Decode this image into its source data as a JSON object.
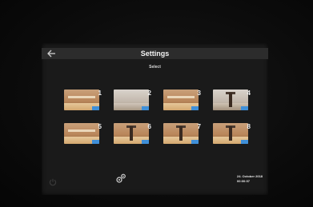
{
  "header": {
    "back_icon": "back-arrow-icon",
    "title": "Settings"
  },
  "subtitle": "Select",
  "tiles": [
    {
      "number": "1",
      "scene": "shelf"
    },
    {
      "number": "2",
      "scene": "light"
    },
    {
      "number": "3",
      "scene": "shelf"
    },
    {
      "number": "4",
      "scene": "post"
    },
    {
      "number": "5",
      "scene": "shelf"
    },
    {
      "number": "6",
      "scene": "post"
    },
    {
      "number": "7",
      "scene": "post"
    },
    {
      "number": "8",
      "scene": "post"
    }
  ],
  "footer": {
    "power_icon": "power-icon",
    "gears_icon": "gears-icon",
    "date": "24. October 2018",
    "time": "00:00:07"
  },
  "colors": {
    "screen_bg": "#1a1a1a",
    "titlebar_bg": "#2c2c2c",
    "tile_accent": "#3f8fd8"
  }
}
